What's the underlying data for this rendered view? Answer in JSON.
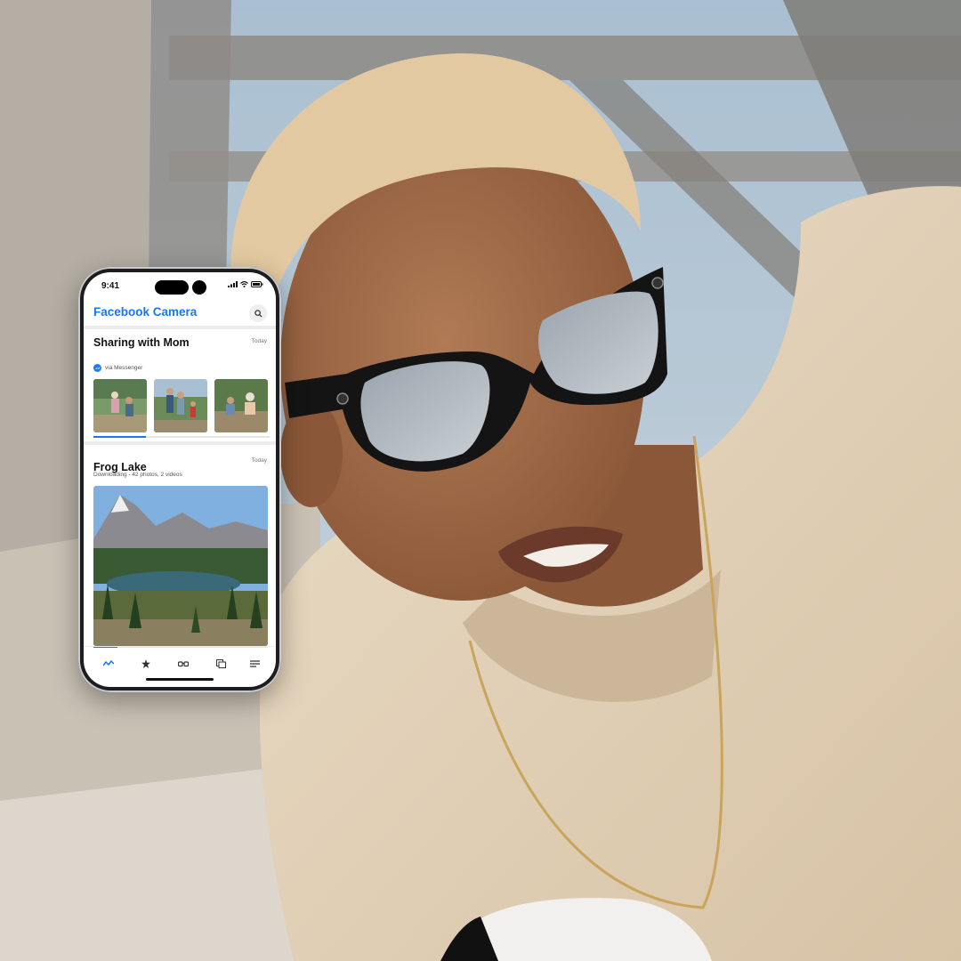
{
  "status_bar": {
    "time": "9:41"
  },
  "app": {
    "title": "Facebook Camera"
  },
  "cards": [
    {
      "title": "Sharing with Mom",
      "date": "Today",
      "via": "via Messenger",
      "progress": 0.3
    },
    {
      "title": "Frog Lake",
      "date": "Today",
      "subtitle": "Downloading - 42 photos, 2 videos",
      "progress": 0.14
    }
  ],
  "tabs": [
    {
      "icon": "activity-icon",
      "active": true
    },
    {
      "icon": "star-icon",
      "active": false
    },
    {
      "icon": "glasses-icon",
      "active": false
    },
    {
      "icon": "gallery-icon",
      "active": false
    },
    {
      "icon": "menu-icon",
      "active": false
    }
  ],
  "colors": {
    "brand_blue": "#1877f2",
    "messenger_blue": "#1b7cf2"
  }
}
